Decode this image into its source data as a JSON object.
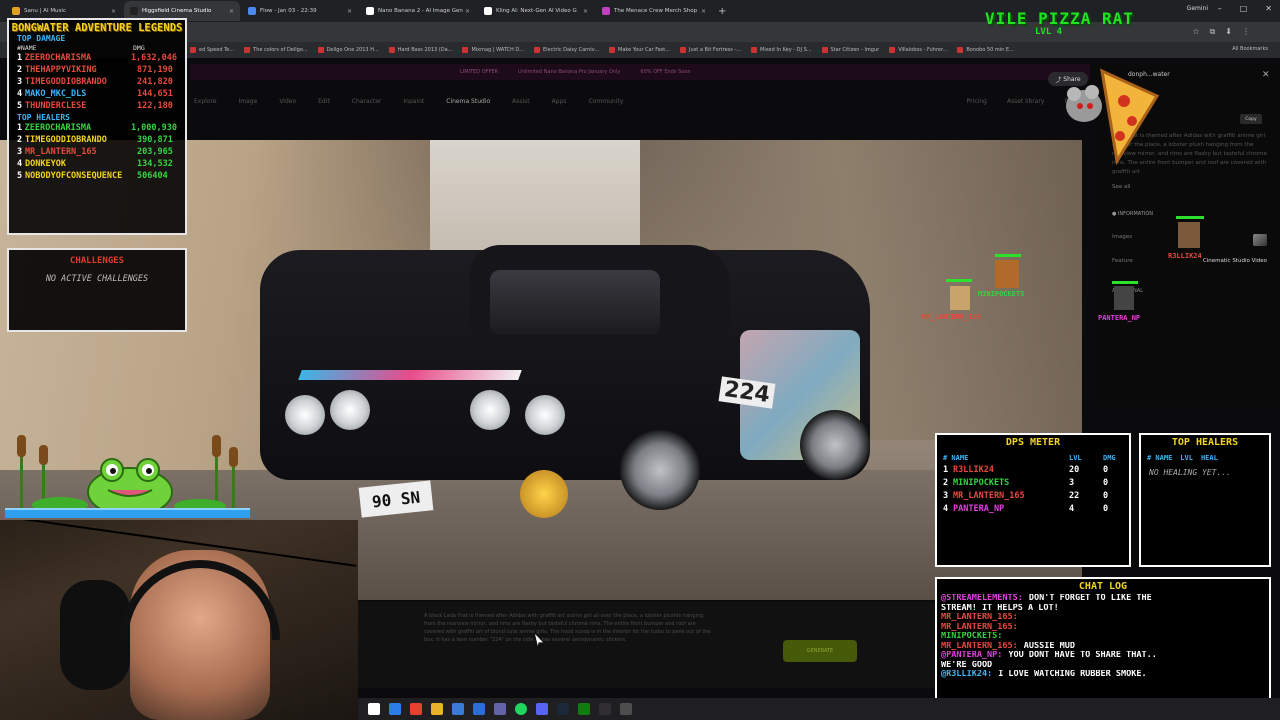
{
  "browser": {
    "tabs": [
      {
        "title": "Sanu | AI Music",
        "fav": "#e0a020",
        "active": false
      },
      {
        "title": "Higgsfield Cinema Studio",
        "fav": "#222",
        "active": true
      },
      {
        "title": "Flow - Jan 03 - 22:39",
        "fav": "#4a8af0",
        "active": false
      },
      {
        "title": "Nano Banana 2 - AI Image Gen",
        "fav": "#fff",
        "active": false
      },
      {
        "title": "Kling AI: Next-Gen AI Video G",
        "fav": "#fff",
        "active": false
      },
      {
        "title": "The Menace Crew Merch Shop",
        "fav": "#c040c0",
        "active": false
      }
    ],
    "profile": "Gemini",
    "bookmarks": [
      "ed Speed Te...",
      "The colors of Dellgo...",
      "Dellgo One 2013 H...",
      "Hard Bass 2013 (Da...",
      "Mixmag | WATCH D...",
      "Electric Daisy Carniv...",
      "Make Your Car Fast...",
      "Just a Bit Fortress -...",
      "Mixed In Key - DJ S...",
      "Star Citizen - Imgur",
      "Villalobos - Fuhrer...",
      "Bonobo 50 min E..."
    ],
    "all_bookmarks": "All Bookmarks"
  },
  "site": {
    "promo": [
      "LIMITED OFFER",
      "Unlimited Nano Banana Pro January Only",
      "60% OFF Ends Soon"
    ],
    "nav": [
      "Explore",
      "Image",
      "Video",
      "Edit",
      "Character",
      "Inpaint",
      "Cinema Studio",
      "Assist",
      "Apps",
      "Community"
    ],
    "nav_current": "Cinema Studio",
    "nav_right": [
      "Pricing",
      "Asset library",
      "Personal"
    ],
    "plate": "90 SN",
    "car_number": "224",
    "prompt": "A black Lada that is themed after Adidas with graffiti art anime girl all over the place, a lobster plushie hanging from the rearview mirror, and rims are flashy but tasteful chrome rims. The entire front bumper and roof are covered with graffiti art of blond cute anime girls. The hood scoop is in the interior for the turbo to peek out of the box. It has a lane number \"224\" on the side. It has several aerodynamic stickers.",
    "generate": "GENERATE"
  },
  "side_panel": {
    "share": "Share",
    "user": "donph...water",
    "copy": "Copy",
    "desc": "Lada that is themed after Adidas with graffiti anime girl all over the place, a lobster plush hanging from the rearview mirror, and rims are flashy but tasteful chrome rims. The entire front bumper and roof are covered with graffiti art",
    "see_all": "See all",
    "info": "INFORMATION",
    "rows": [
      {
        "k": "Images",
        "v": ""
      },
      {
        "k": "Feature",
        "v": "Cinematic Studio Video"
      }
    ],
    "additional": "ADDITIONAL"
  },
  "overlay": {
    "brand": "VILE PIZZA RAT",
    "brand_level": "LVL 4",
    "legends": {
      "title": "BONGWATER ADVENTURE LEGENDS",
      "damage_title": "TOP DAMAGE",
      "damage_cols": [
        "#NAME",
        "DMG"
      ],
      "damage": [
        {
          "rank": "1",
          "name": "ZEEROCHARISMA",
          "value": "1,632,046",
          "color": "#e64a3c"
        },
        {
          "rank": "2",
          "name": "THEHAPPYVIKING",
          "value": "871,190",
          "color": "#e64a3c"
        },
        {
          "rank": "3",
          "name": "TIMEGODDIOBRANDO",
          "value": "241,820",
          "color": "#e64a3c"
        },
        {
          "rank": "4",
          "name": "MAKO_MKC_DLS",
          "value": "144,651",
          "color": "#3fb4f5"
        },
        {
          "rank": "5",
          "name": "THUNDERCLESE",
          "value": "122,180",
          "color": "#e64a3c"
        }
      ],
      "healers_title": "TOP HEALERS",
      "healers": [
        {
          "rank": "1",
          "name": "ZEEROCHARISMA",
          "value": "1,000,930",
          "color": "#35d441"
        },
        {
          "rank": "2",
          "name": "TIMEGODDIOBRANDO",
          "value": "390,871",
          "color": "#f2d41f"
        },
        {
          "rank": "3",
          "name": "MR_LANTERN_165",
          "value": "203,965",
          "color": "#e64a3c"
        },
        {
          "rank": "4",
          "name": "DONKEYOK",
          "value": "134,532",
          "color": "#f2d41f"
        },
        {
          "rank": "5",
          "name": "NOBODYOFCONSEQUENCE",
          "value": "506404",
          "color": "#f2d41f"
        }
      ]
    },
    "challenges": {
      "title": "CHALLENGES",
      "empty": "NO ACTIVE CHALLENGES"
    },
    "sprites": [
      {
        "name": "R3LLIK24",
        "color": "#e64a3c"
      },
      {
        "name": "MINIPOCKETS",
        "color": "#35d441"
      },
      {
        "name": "MR_LANTERN_165",
        "color": "#e64a3c"
      },
      {
        "name": "PANTERA_NP",
        "color": "#e040e0"
      }
    ],
    "dps": {
      "title": "DPS METER",
      "cols": [
        "# NAME",
        "LVL",
        "DMG"
      ],
      "rows": [
        {
          "rank": "1",
          "name": "R3LLIK24",
          "lvl": "20",
          "dmg": "0",
          "color": "#e64a3c"
        },
        {
          "rank": "2",
          "name": "MINIPOCKETS",
          "lvl": "3",
          "dmg": "0",
          "color": "#35d441"
        },
        {
          "rank": "3",
          "name": "MR_LANTERN_165",
          "lvl": "22",
          "dmg": "0",
          "color": "#e64a3c"
        },
        {
          "rank": "4",
          "name": "PANTERA_NP",
          "lvl": "4",
          "dmg": "0",
          "color": "#e040e0"
        }
      ]
    },
    "healers_panel": {
      "title": "TOP HEALERS",
      "cols": [
        "# NAME",
        "LVL",
        "HEAL"
      ],
      "empty": "NO HEALING YET..."
    },
    "chat": {
      "title": "CHAT LOG",
      "lines": [
        {
          "user": "@STREAMELEMENTS:",
          "text": "DON'T FORGET TO LIKE THE",
          "ucolor": "#e040e0"
        },
        {
          "user": "",
          "text": "STREAM! IT HELPS A LOT!",
          "ucolor": "#fff"
        },
        {
          "user": "MR_LANTERN_165:",
          "text": "",
          "ucolor": "#e64a3c"
        },
        {
          "user": "MR_LANTERN_165:",
          "text": "",
          "ucolor": "#e64a3c"
        },
        {
          "user": "MINIPOCKETS:",
          "text": "",
          "ucolor": "#35d441"
        },
        {
          "user": "MR_LANTERN_165:",
          "text": "AUSSIE MUD",
          "ucolor": "#e64a3c"
        },
        {
          "user": "@PANTERA_NP:",
          "text": "YOU DONT HAVE TO SHARE THAT..",
          "ucolor": "#e040e0"
        },
        {
          "user": "",
          "text": "WE'RE GOOD",
          "ucolor": "#fff"
        },
        {
          "user": "@R3LLIK24:",
          "text": "I LOVE WATCHING RUBBER SMOKE.",
          "ucolor": "#3fb4f5"
        }
      ]
    }
  },
  "taskbar": {
    "icons": [
      "start-icon",
      "edge-icon",
      "chrome-icon",
      "files-icon",
      "store-icon",
      "mail-icon",
      "teams-icon",
      "spotify-icon",
      "discord-icon",
      "steam-icon",
      "xbox-icon",
      "obs-icon",
      "terminal-icon"
    ],
    "colors": [
      "#fff",
      "#2b7de9",
      "#e5412d",
      "#e8b32a",
      "#3a7bd5",
      "#2b6fd6",
      "#6264a7",
      "#1ed760",
      "#5865f2",
      "#1b2838",
      "#107c10",
      "#302e31",
      "#4d4d4d"
    ]
  }
}
